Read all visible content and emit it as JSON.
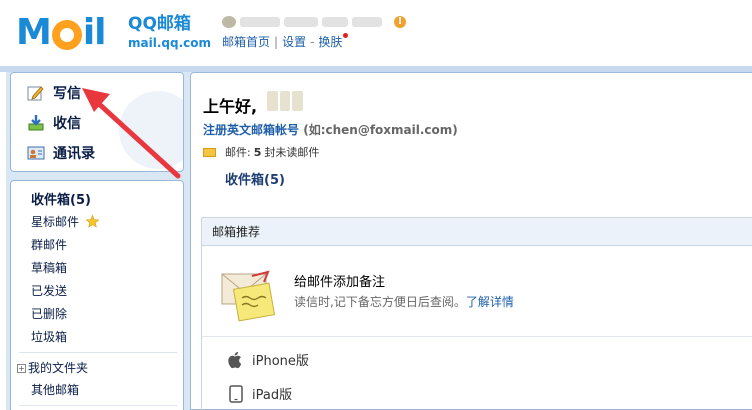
{
  "header": {
    "logo_text_left": "M",
    "logo_text_right": "il",
    "brand": "QQ邮箱",
    "url": "mail.qq.com",
    "links": [
      "邮箱首页",
      "设置",
      "换肤"
    ],
    "warn_glyph": "!"
  },
  "sidebar": {
    "actions": [
      {
        "label": "写信",
        "icon": "pencil-icon"
      },
      {
        "label": "收信",
        "icon": "download-icon"
      },
      {
        "label": "通讯录",
        "icon": "contact-card-icon"
      }
    ],
    "folders": [
      "收件箱(5)",
      "星标邮件",
      "群邮件",
      "草稿箱",
      "已发送",
      "已删除",
      "垃圾箱"
    ],
    "my_folders": "我的文件夹",
    "other_mail": "其他邮箱"
  },
  "main": {
    "greeting": "上午好,",
    "register_link": "注册英文邮箱帐号",
    "register_hint": "(如:chen@foxmail.com)",
    "mail_label": "邮件:",
    "mail_count": "5",
    "mail_suffix": "封未读邮件",
    "inbox_link": "收件箱(5)",
    "recommend": {
      "heading": "邮箱推荐",
      "title": "给邮件添加备注",
      "desc": "读信时,记下备忘方便日后查阅。",
      "more": "了解详情"
    },
    "apps": [
      {
        "label": "iPhone版",
        "icon": "apple-icon"
      },
      {
        "label": "iPad版",
        "icon": "tablet-icon"
      }
    ]
  },
  "colors": {
    "brand_blue": "#1a8ad6",
    "logo_orange": "#ffa11f",
    "link_blue": "#1f5fa8",
    "arrow_red": "#e8383d"
  }
}
